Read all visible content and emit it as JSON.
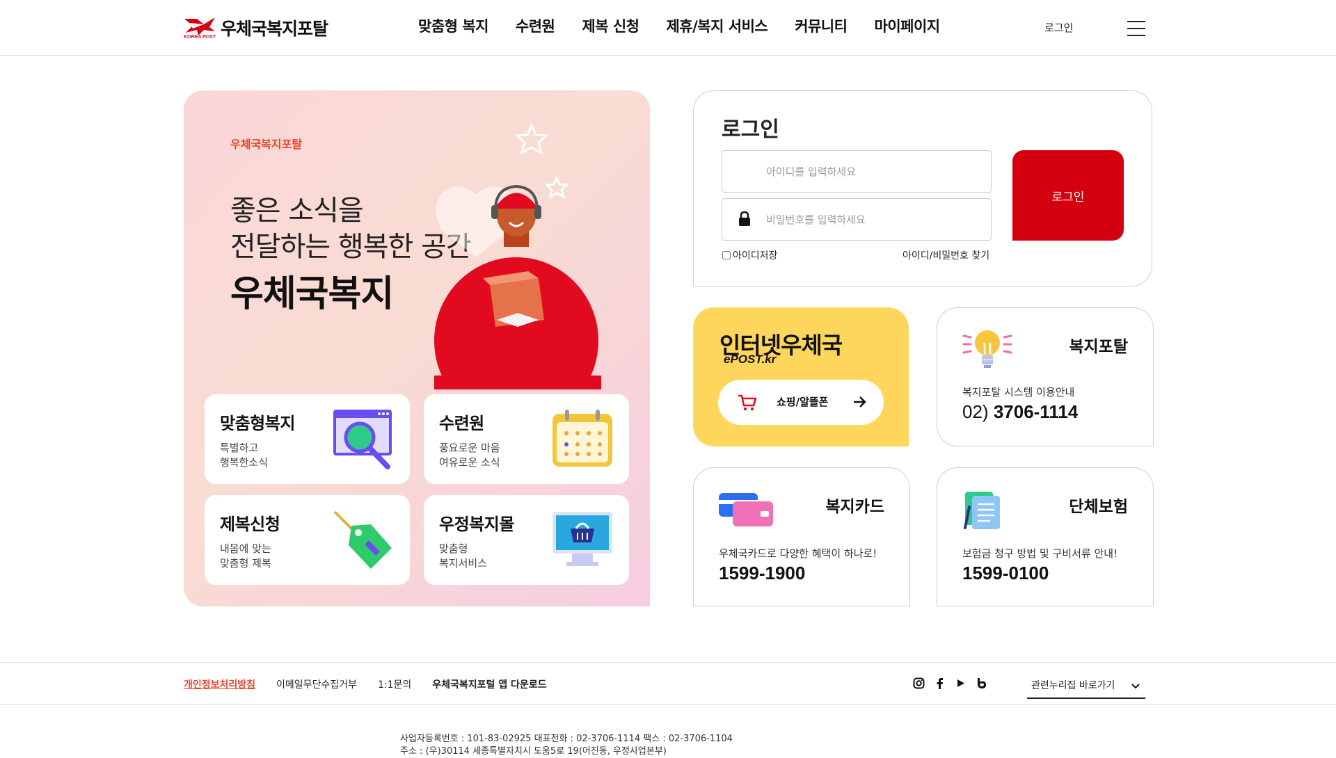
{
  "header": {
    "logo_text": "우체국복지포탈",
    "logo_sub": "KOREA POST",
    "nav": [
      "맞춤형 복지",
      "수련원",
      "제복 신청",
      "제휴/복지 서비스",
      "커뮤니티",
      "마이페이지"
    ],
    "login_label": "로그인"
  },
  "hero": {
    "eyebrow": "우체국복지포탈",
    "line1": "좋은 소식을",
    "line2": "전달하는 행복한 공간",
    "title": "우체국복지",
    "tiles": [
      {
        "title": "맞춤형복지",
        "desc1": "특별하고",
        "desc2": "행복한소식",
        "icon": "magnifier-icon"
      },
      {
        "title": "수련원",
        "desc1": "풍요로운 마음",
        "desc2": "여유로운 소식",
        "icon": "calendar-icon"
      },
      {
        "title": "제복신청",
        "desc1": "내몸에 맞는",
        "desc2": "맞춤형 제복",
        "icon": "tag-icon"
      },
      {
        "title": "우정복지몰",
        "desc1": "맞춤형",
        "desc2": "복지서비스",
        "icon": "shopping-basket-monitor-icon"
      }
    ]
  },
  "login": {
    "title": "로그인",
    "id_placeholder": "아이디를 입력하세요",
    "pw_placeholder": "비밀번호를 입력하세요",
    "button": "로그인",
    "save_id": "아이디저장",
    "find": "아이디/비밀번호 찾기"
  },
  "epost": {
    "title": "인터넷우체국",
    "subtitle": "ePOST.kr",
    "button": "쇼핑/알뜰폰"
  },
  "cards": [
    {
      "title": "복지포탈",
      "desc": "복지포탈 시스템 이용안내",
      "phone_prefix": "02)",
      "phone": "3706-1114",
      "icon": "lightbulb-icon"
    },
    {
      "title": "복지카드",
      "desc": "우체국카드로 다양한 혜택이 하나로!",
      "phone": "1599-1900",
      "icon": "card-icon"
    },
    {
      "title": "단체보험",
      "desc": "보험금 청구 방법 및 구비서류 안내!",
      "phone": "1599-0100",
      "icon": "document-icon"
    }
  ],
  "footer": {
    "links": [
      "개인정보처리방침",
      "이메일무단수집거부",
      "1:1문의",
      "우체국복지포털 앱 다운로드"
    ],
    "social": [
      "instagram-icon",
      "facebook-icon",
      "youtube-icon",
      "blog-icon"
    ],
    "related": "관련누리집 바로가기",
    "biz_line1": "사업자등록번호 : 101-83-02925 대표전화 : 02-3706-1114 팩스 : 02-3706-1104",
    "biz_line2": "주소 : (우)30114 세종특별자치시 도움5로 19(어진동, 우정사업본부)"
  },
  "colors": {
    "brand_red": "#d4000f",
    "accent_orange": "#e8452c",
    "epost_yellow": "#fed65b"
  }
}
